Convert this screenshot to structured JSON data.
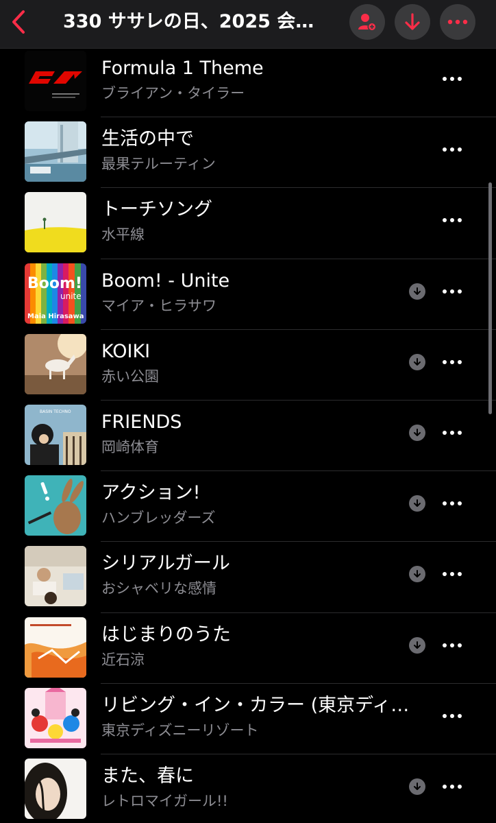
{
  "nav": {
    "title": "330 ササレの日、2025 会…",
    "back_icon": "chevron-left-icon",
    "add_person_icon": "person-add-icon",
    "download_icon": "arrow-down-icon",
    "more_icon": "ellipsis-icon",
    "accent": "#fa2d48"
  },
  "tracks": [
    {
      "title": "Formula 1 Theme",
      "artist": "ブライアン・タイラー",
      "downloadable": false
    },
    {
      "title": "生活の中で",
      "artist": "最果テルーティン",
      "downloadable": false
    },
    {
      "title": "トーチソング",
      "artist": "水平線",
      "downloadable": false
    },
    {
      "title": "Boom! - Unite",
      "artist": "マイア・ヒラサワ",
      "downloadable": true
    },
    {
      "title": "KOIKI",
      "artist": "赤い公園",
      "downloadable": true
    },
    {
      "title": "FRIENDS",
      "artist": "岡崎体育",
      "downloadable": true
    },
    {
      "title": "アクション!",
      "artist": "ハンブレッダーズ",
      "downloadable": true
    },
    {
      "title": "シリアルガール",
      "artist": "おシャベリな感情",
      "downloadable": true
    },
    {
      "title": "はじまりのうた",
      "artist": "近石涼",
      "downloadable": true
    },
    {
      "title": "リビング・イン・カラー (東京ディ…",
      "artist": "東京ディズニーリゾート",
      "downloadable": false
    },
    {
      "title": "また、春に",
      "artist": "レトロマイガール!!",
      "downloadable": true
    }
  ],
  "artwork_text": {
    "boom_title": "Boom!",
    "boom_sub": "unite",
    "boom_artist": "Maia Hirasawa",
    "friends_label": "BASIN TECHNO"
  }
}
